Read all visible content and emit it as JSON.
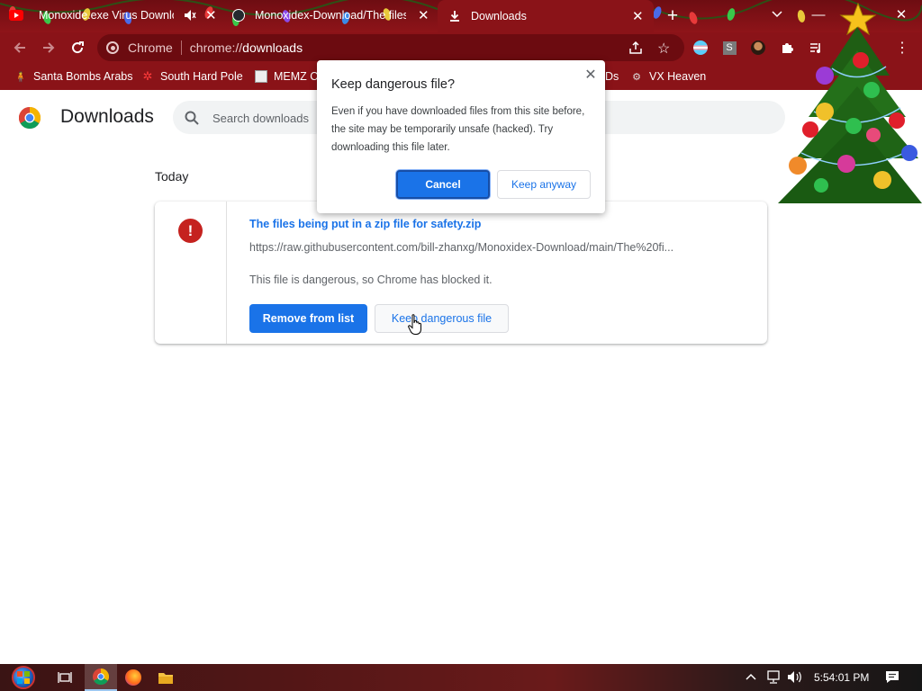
{
  "tabs": [
    {
      "title": "Monoxide.exe Virus Downlo",
      "state": "audio-muted"
    },
    {
      "title": "Monoxidex-Download/The files"
    },
    {
      "title": "Downloads",
      "active": true
    }
  ],
  "toolbar": {
    "omnibox_label": "Chrome",
    "url_scheme": "chrome://",
    "url_host": "downloads"
  },
  "bookmarks": [
    {
      "label": "Santa Bombs Arabs"
    },
    {
      "label": "South Hard Pole"
    },
    {
      "label": "MEMZ C"
    },
    {
      "label": "Ds"
    },
    {
      "label": "VX Heaven"
    }
  ],
  "page": {
    "title": "Downloads",
    "search_placeholder": "Search downloads",
    "section": "Today"
  },
  "download": {
    "file_name": "The files being put in a zip file for safety.zip",
    "url": "https://raw.githubusercontent.com/bill-zhanxg/Monoxidex-Download/main/The%20fi...",
    "status": "This file is dangerous, so Chrome has blocked it.",
    "remove_label": "Remove from list",
    "keep_label": "Keep dangerous file"
  },
  "dialog": {
    "title": "Keep dangerous file?",
    "body": "Even if you have downloaded files from this site before, the site may be temporarily unsafe (hacked). Try downloading this file later.",
    "cancel_label": "Cancel",
    "keep_label": "Keep anyway"
  },
  "taskbar": {
    "clock": "5:54:01 PM"
  },
  "colors": {
    "theme_red": "#8a1318",
    "accent_blue": "#1a73e8",
    "danger_red": "#c5221f"
  }
}
